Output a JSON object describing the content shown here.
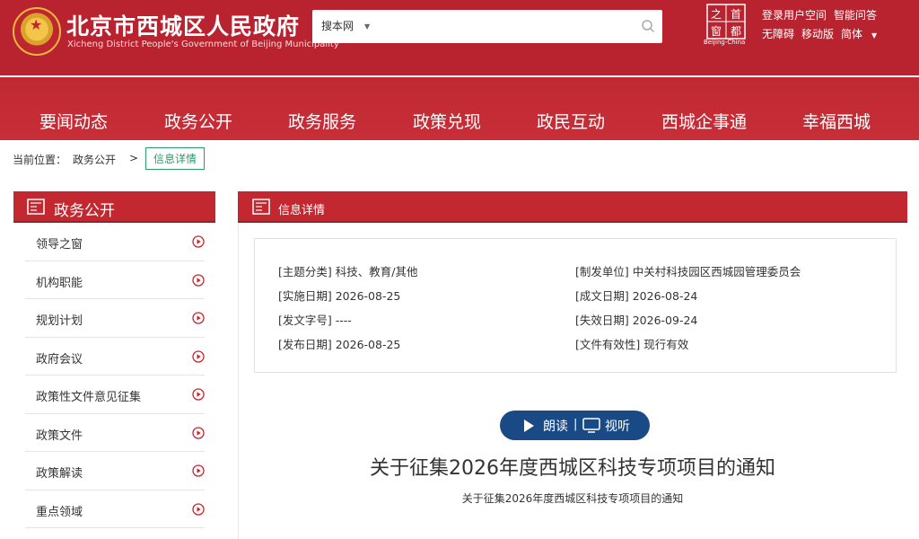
{
  "header": {
    "title": "北京市西城区人民政府",
    "subtitle": "Xicheng District People's Government of Beijing Municipality",
    "search_scope": "搜本网",
    "search_placeholder": "",
    "seal_caption": "Beijing-China",
    "top_links_row1": [
      "登录用户空间",
      "智能问答"
    ],
    "top_links_row2": [
      "无障碍",
      "移动版",
      "简体"
    ]
  },
  "nav": {
    "items": [
      "要闻动态",
      "政务公开",
      "政务服务",
      "政策兑现",
      "政民互动",
      "西城企事通",
      "幸福西城"
    ]
  },
  "breadcrumb": {
    "label": "当前位置：",
    "crumb": "政务公开",
    "separator": ">",
    "current": "信息详情"
  },
  "sidebar": {
    "title": "政务公开",
    "items": [
      "领导之窗",
      "机构职能",
      "规划计划",
      "政府会议",
      "政策性文件意见征集",
      "政策文件",
      "政策解读",
      "重点领域"
    ]
  },
  "main": {
    "title": "信息详情",
    "meta": {
      "subject": "[主题分类] 科技、教育/其他",
      "issuer": "[制发单位] 中关村科技园区西城园管理委员会",
      "effective_date": "[实施日期] 2026-08-25",
      "created_date": "[成文日期] 2026-08-24",
      "doc_number": "[发文字号] ----",
      "expiry_date": "[失效日期] 2026-09-24",
      "publish_date": "[发布日期] 2026-08-25",
      "validity": "[文件有效性] 现行有效"
    },
    "read_label": "朗读",
    "divider": "|",
    "watch_label": "视听",
    "doc_title": "关于征集2026年度西城区科技专项项目的通知",
    "doc_subtitle": "关于征集2026年度西城区科技专项项目的通知"
  },
  "colors": {
    "brand_red": "#c3272f",
    "pill_blue": "#1a4a85",
    "breadcrumb_green": "#2e9c69"
  }
}
